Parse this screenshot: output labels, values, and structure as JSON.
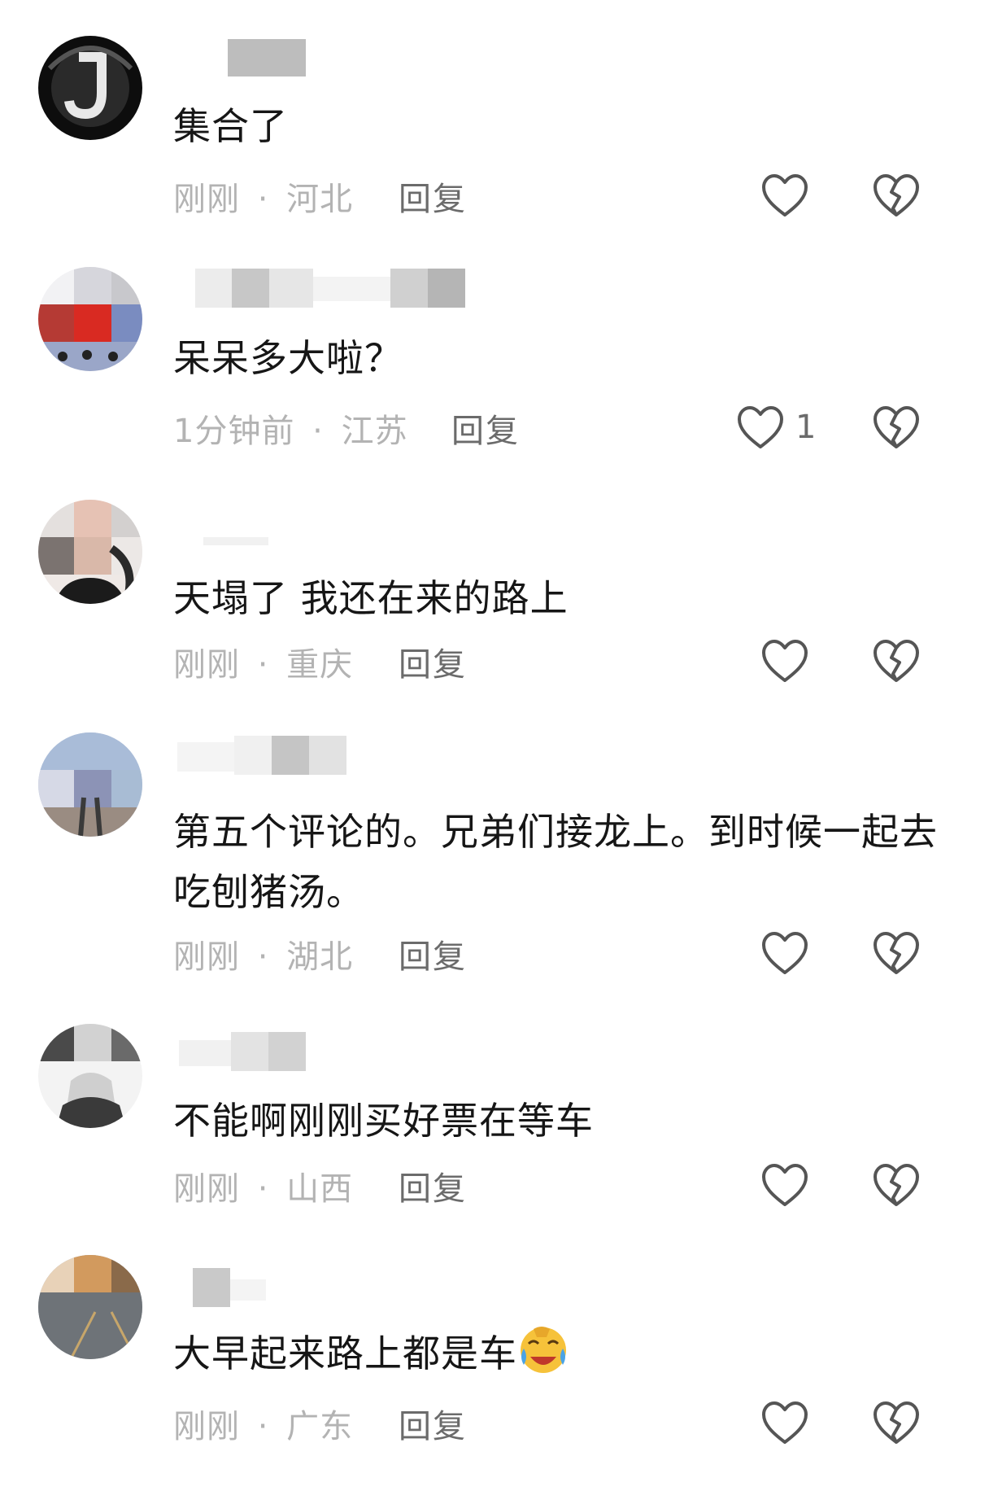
{
  "comments": [
    {
      "text": "集合了",
      "time": "刚刚",
      "location": "河北",
      "reply_label": "回复",
      "like_count": ""
    },
    {
      "text": "呆呆多大啦？",
      "time": "1分钟前",
      "location": "江苏",
      "reply_label": "回复",
      "like_count": "1"
    },
    {
      "text": "天塌了   我还在来的路上",
      "time": "刚刚",
      "location": "重庆",
      "reply_label": "回复",
      "like_count": ""
    },
    {
      "text": "第五个评论的。兄弟们接龙上。到时候一起去吃刨猪汤。",
      "time": "刚刚",
      "location": "湖北",
      "reply_label": "回复",
      "like_count": ""
    },
    {
      "text": "不能啊刚刚买好票在等车",
      "time": "刚刚",
      "location": "山西",
      "reply_label": "回复",
      "like_count": ""
    },
    {
      "text": "大早起来路上都是车",
      "time": "刚刚",
      "location": "广东",
      "reply_label": "回复",
      "like_count": ""
    }
  ],
  "separator": "·",
  "icons": {
    "like": "heart-outline-icon",
    "dislike": "broken-heart-icon",
    "emoji": "crying-laughing-emoji"
  },
  "colors": {
    "text": "#161616",
    "meta": "#b3b3b3",
    "action": "#6b6b6b"
  }
}
